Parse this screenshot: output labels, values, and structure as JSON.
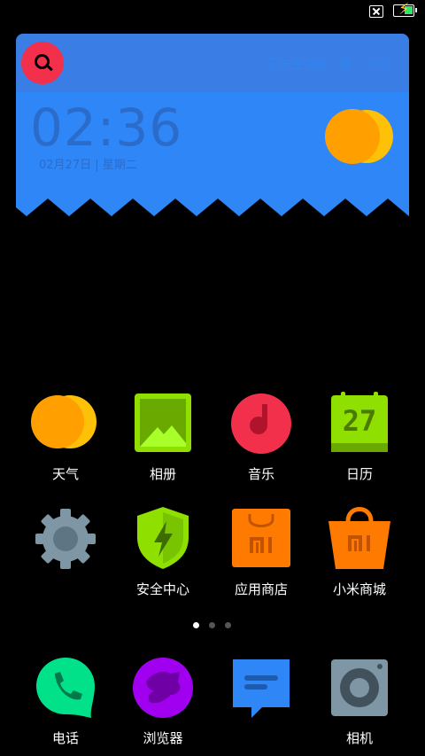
{
  "status_bar": {
    "icons": [
      "sim-missing-icon",
      "battery-charging-icon"
    ],
    "battery_color": "#2ee86a",
    "bolt_glyph": "⚡"
  },
  "widget": {
    "location": "安宁庄南路",
    "weather": "霾",
    "temperature": "7℃",
    "time": "02:36",
    "date": "02月27日 | 星期二",
    "colors": {
      "panel": "#3a7de4",
      "search": "#f3304c",
      "sun": "#ffa000"
    }
  },
  "apps": [
    {
      "label": "天气",
      "icon": "weather-sun-icon"
    },
    {
      "label": "相册",
      "icon": "gallery-icon"
    },
    {
      "label": "音乐",
      "icon": "music-icon"
    },
    {
      "label": "日历",
      "icon": "calendar-icon",
      "day": "27"
    },
    {
      "label": "",
      "icon": "settings-gear-icon"
    },
    {
      "label": "安全中心",
      "icon": "security-shield-icon"
    },
    {
      "label": "应用商店",
      "icon": "app-store-icon"
    },
    {
      "label": "小米商城",
      "icon": "mi-store-icon"
    }
  ],
  "dock": [
    {
      "label": "电话",
      "icon": "phone-icon"
    },
    {
      "label": "浏览器",
      "icon": "browser-icon"
    },
    {
      "label": "",
      "icon": "messages-icon"
    },
    {
      "label": "相机",
      "icon": "camera-icon"
    }
  ],
  "pages": {
    "count": 3,
    "current": 0
  }
}
